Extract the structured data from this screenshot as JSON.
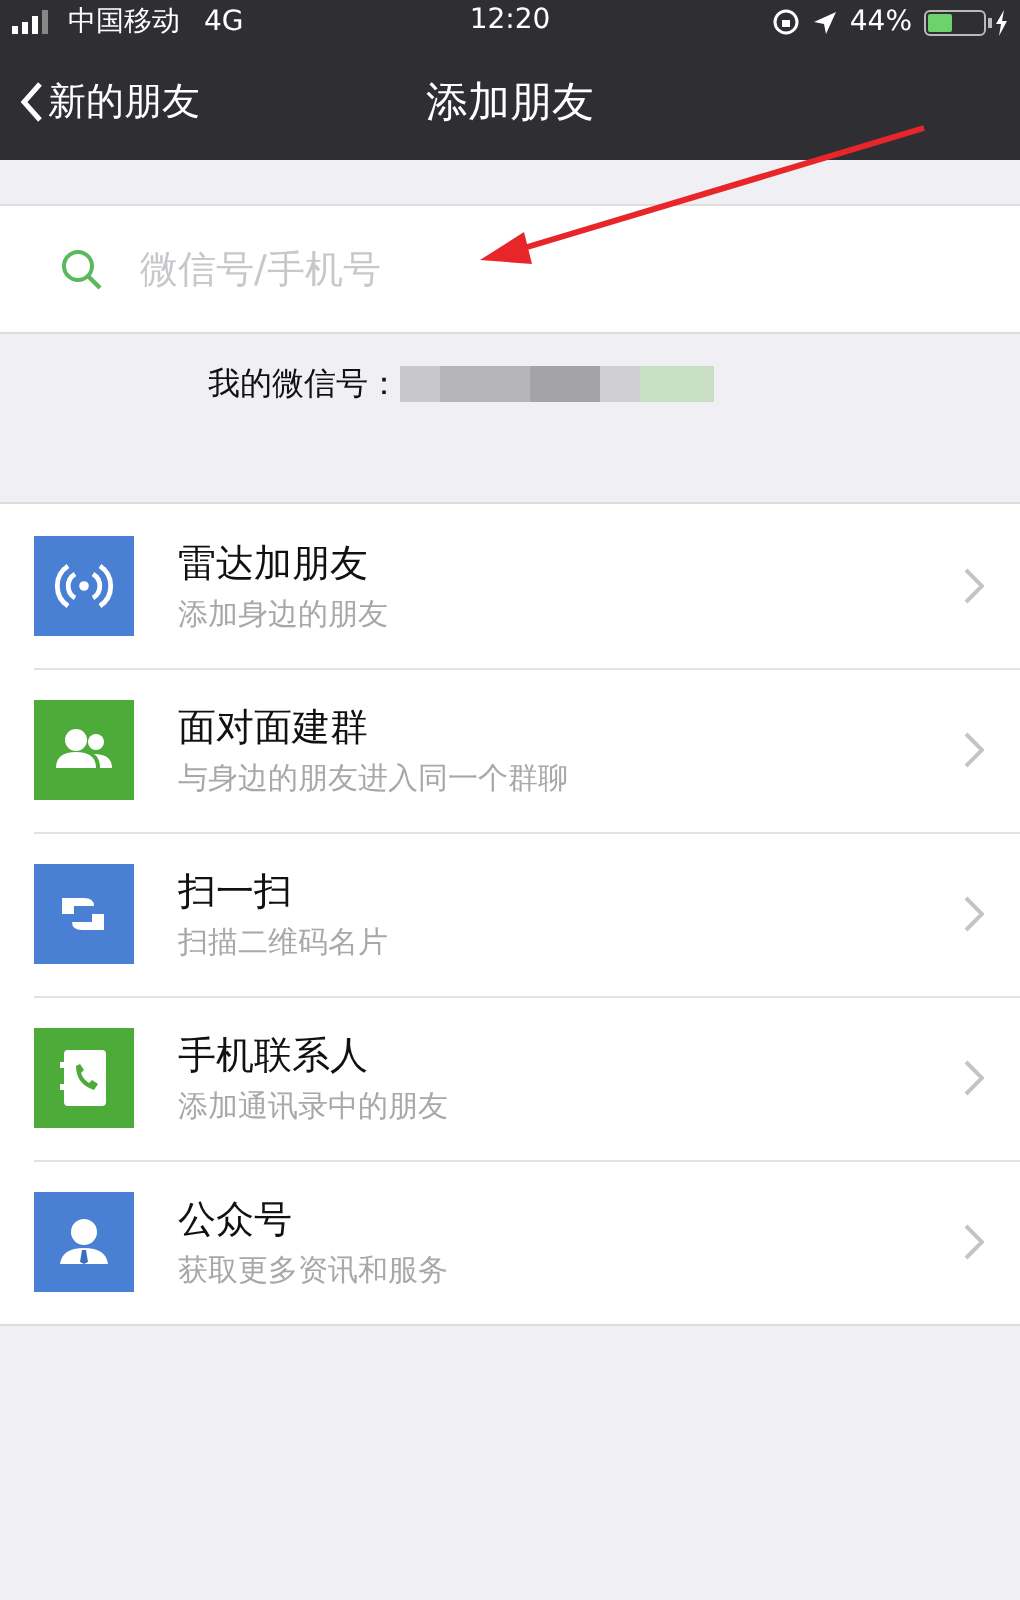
{
  "status_bar": {
    "carrier": "中国移动",
    "network": "4G",
    "time": "12:20",
    "battery": "44%"
  },
  "nav": {
    "back": "新的朋友",
    "title": "添加朋友"
  },
  "search": {
    "placeholder": "微信号/手机号"
  },
  "my_id": {
    "label": "我的微信号："
  },
  "items": [
    {
      "kind": "radar",
      "color": "#4a80d4",
      "title": "雷达加朋友",
      "subtitle": "添加身边的朋友"
    },
    {
      "kind": "group",
      "color": "#4dab3a",
      "title": "面对面建群",
      "subtitle": "与身边的朋友进入同一个群聊"
    },
    {
      "kind": "scan",
      "color": "#4a80d4",
      "title": "扫一扫",
      "subtitle": "扫描二维码名片"
    },
    {
      "kind": "contacts",
      "color": "#4dab3a",
      "title": "手机联系人",
      "subtitle": "添加通讯录中的朋友"
    },
    {
      "kind": "official",
      "color": "#4a80d4",
      "title": "公众号",
      "subtitle": "获取更多资讯和服务"
    }
  ]
}
